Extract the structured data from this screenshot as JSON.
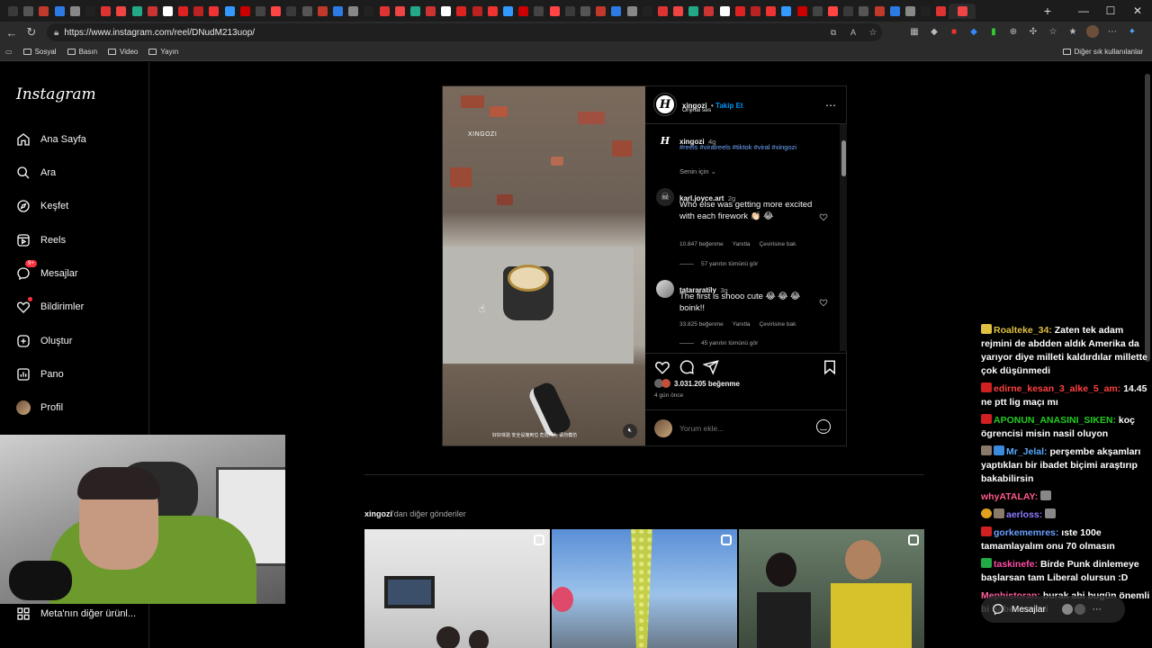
{
  "browser": {
    "url": "https://www.instagram.com/reel/DNudM213uop/",
    "bookmarks": [
      "Sosyal",
      "Basın",
      "Video",
      "Yayın"
    ],
    "bookmarks_right": "Diğer sık kullanılanlar"
  },
  "sidebar": {
    "logo": "Instagram",
    "items": [
      {
        "label": "Ana Sayfa",
        "icon": "home-icon"
      },
      {
        "label": "Ara",
        "icon": "search-icon"
      },
      {
        "label": "Keşfet",
        "icon": "compass-icon"
      },
      {
        "label": "Reels",
        "icon": "reels-icon"
      },
      {
        "label": "Mesajlar",
        "icon": "messenger-icon",
        "badge": "9+"
      },
      {
        "label": "Bildirimler",
        "icon": "heart-icon"
      },
      {
        "label": "Oluştur",
        "icon": "plus-square-icon"
      },
      {
        "label": "Pano",
        "icon": "chart-icon"
      },
      {
        "label": "Profil",
        "icon": "avatar-icon"
      }
    ],
    "meta_link": "Meta'nın diğer ürünl..."
  },
  "post": {
    "username": "xingozi",
    "follow": "Takip Et",
    "audio": "Orijinal ses",
    "video_watermark": "XINGOZI",
    "video_subtitle": "好好体验 安全设施到位 危险行为 请勿模仿",
    "caption": {
      "username": "xingozi",
      "time": "4g",
      "hashtags": "#reels #viralreels #tiktok #viral #xingozi"
    },
    "sort_label": "Senin için",
    "comments": [
      {
        "username": "karl.joyce.art",
        "time": "2g",
        "text": "Who else was getting more excited with each firework 👏🏻 😂",
        "likes": "10.847 beğenme",
        "reply": "Yanıtla",
        "translate": "Çevirisine bak",
        "view_replies": "57 yanıtın tümünü gör"
      },
      {
        "username": "tatararatily",
        "time": "3g",
        "text": "The first is shooo cute 😂 😂 😂 boink!!",
        "likes": "33.825 beğenme",
        "reply": "Yanıtla",
        "translate": "Çevirisine bak",
        "view_replies": "45 yanıtın tümünü gör"
      }
    ],
    "like_count": "3.031.205 beğenme",
    "posted": "4 gün önce",
    "comment_placeholder": "Yorum ekle..."
  },
  "more_posts": {
    "username": "xingozi",
    "suffix": "'dan diğer gönderiler"
  },
  "chat": [
    {
      "user": "Roalteke_34:",
      "text": "Zaten tek adam rejmini de abdden aldık Amerika da yarıyor diye milleti kaldırdılar millette çok düşünmedi",
      "color": "#e0c040"
    },
    {
      "user": "edirne_kesan_3_alke_5_am:",
      "text": "14.45 ne ptt lig maçı mı",
      "color": "#ff4040"
    },
    {
      "user": "APONUN_ANASINI_SIKEN:",
      "text": "koç ögrencisi misin nasil oluyon",
      "color": "#22cc22"
    },
    {
      "user": "Mr_Jelal:",
      "text": "perşembe akşamları yaptıkları bir ibadet biçimi araştırıp bakabilirsin",
      "color": "#55aaff"
    },
    {
      "user": "whyATALAY:",
      "text": "",
      "color": "#ff5a8a"
    },
    {
      "user": "aerloss:",
      "text": "",
      "color": "#8a7cff"
    },
    {
      "user": "gorkememres:",
      "text": "ıste 100e tamamlayalım onu 70 olmasın",
      "color": "#6aa0ff"
    },
    {
      "user": "taskinefe:",
      "text": "Birde Punk dinlemeye başlarsan tam Liberal olursun :D",
      "color": "#ff4da6"
    },
    {
      "user": "Mephistoran:",
      "text": "burak abi bugün önemli bi haber var mi",
      "color": "#ff5fa0"
    }
  ],
  "messages_pill": "Mesajlar",
  "colors": {
    "accent": "#0095f6",
    "badge": "#ff3040"
  }
}
